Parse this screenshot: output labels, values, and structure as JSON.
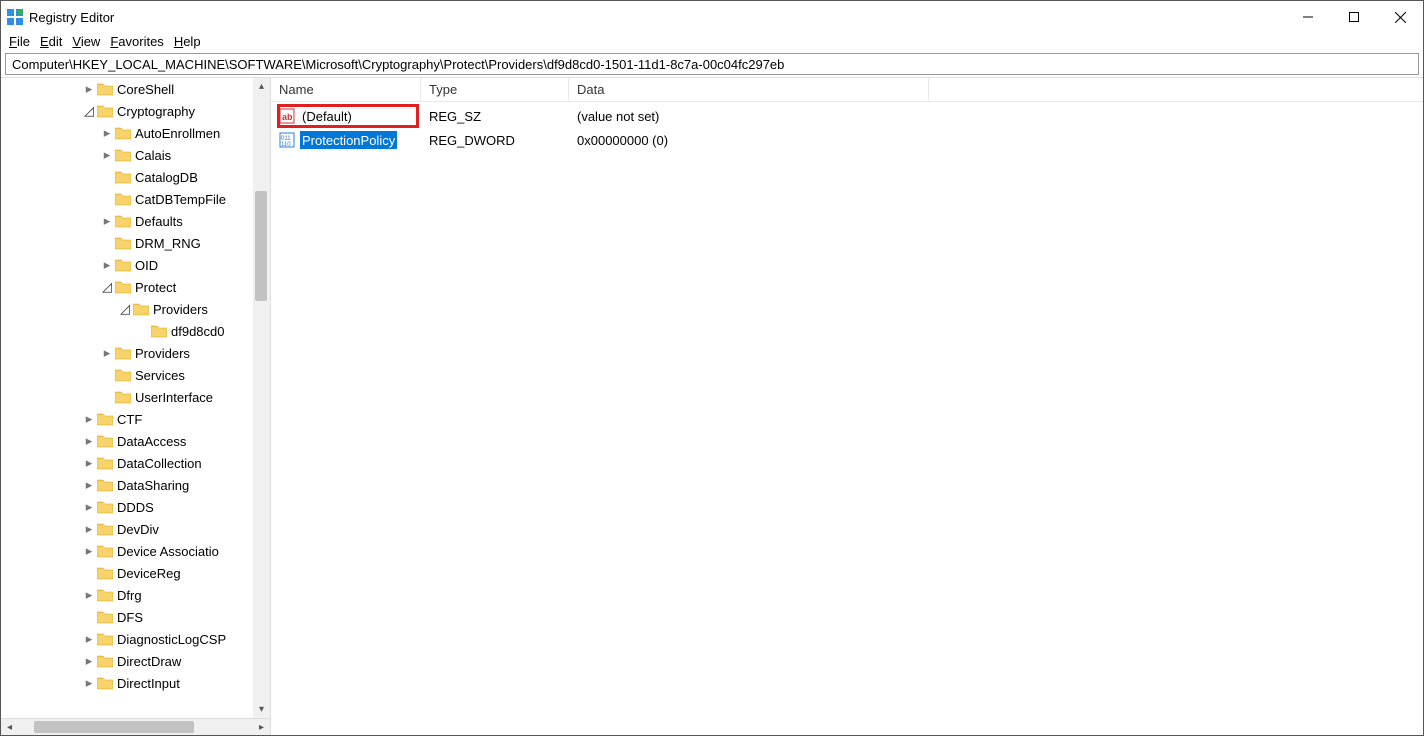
{
  "window": {
    "title": "Registry Editor"
  },
  "menu": {
    "file": "File",
    "edit": "Edit",
    "view": "View",
    "favorites": "Favorites",
    "help": "Help"
  },
  "address": "Computer\\HKEY_LOCAL_MACHINE\\SOFTWARE\\Microsoft\\Cryptography\\Protect\\Providers\\df9d8cd0-1501-11d1-8c7a-00c04fc297eb",
  "tree": {
    "coreshell": "CoreShell",
    "cryptography": "Cryptography",
    "autoenroll": "AutoEnrollmen",
    "calais": "Calais",
    "catalogdb": "CatalogDB",
    "catdbtemp": "CatDBTempFile",
    "defaults": "Defaults",
    "drmrng": "DRM_RNG",
    "oid": "OID",
    "protect": "Protect",
    "providers_inner": "Providers",
    "guid": "df9d8cd0",
    "providers": "Providers",
    "services": "Services",
    "userinterface": "UserInterface",
    "ctf": "CTF",
    "dataaccess": "DataAccess",
    "datacollection": "DataCollection",
    "datasharing": "DataSharing",
    "ddds": "DDDS",
    "devdiv": "DevDiv",
    "deviceassoc": "Device Associatio",
    "devicereg": "DeviceReg",
    "dfrg": "Dfrg",
    "dfs": "DFS",
    "diaglog": "DiagnosticLogCSP",
    "directdraw": "DirectDraw",
    "directinput": "DirectInput"
  },
  "columns": {
    "name": "Name",
    "type": "Type",
    "data": "Data"
  },
  "values": [
    {
      "icon": "sz",
      "name": "(Default)",
      "type": "REG_SZ",
      "data": "(value not set)",
      "selected": false
    },
    {
      "icon": "dword",
      "name": "ProtectionPolicy",
      "type": "REG_DWORD",
      "data": "0x00000000 (0)",
      "selected": true
    }
  ]
}
